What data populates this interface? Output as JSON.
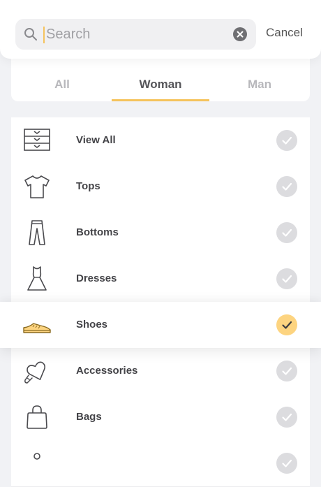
{
  "search": {
    "placeholder": "Search",
    "value": "",
    "cancel_label": "Cancel"
  },
  "tabs": [
    {
      "label": "All",
      "active": false
    },
    {
      "label": "Woman",
      "active": true
    },
    {
      "label": "Man",
      "active": false
    }
  ],
  "categories": [
    {
      "label": "View All",
      "icon": "drawers-icon",
      "checked": false
    },
    {
      "label": "Tops",
      "icon": "tshirt-icon",
      "checked": false
    },
    {
      "label": "Bottoms",
      "icon": "pants-icon",
      "checked": false
    },
    {
      "label": "Dresses",
      "icon": "dress-icon",
      "checked": false
    },
    {
      "label": "Shoes",
      "icon": "shoe-icon",
      "checked": true
    },
    {
      "label": "Accessories",
      "icon": "heart-pendant-icon",
      "checked": false
    },
    {
      "label": "Bags",
      "icon": "bag-icon",
      "checked": false
    },
    {
      "label": "",
      "icon": "partial-icon",
      "checked": false
    }
  ],
  "colors": {
    "accent": "#f5c35c",
    "check_selected": "#fdd480",
    "check_default": "#dcdcdf"
  }
}
